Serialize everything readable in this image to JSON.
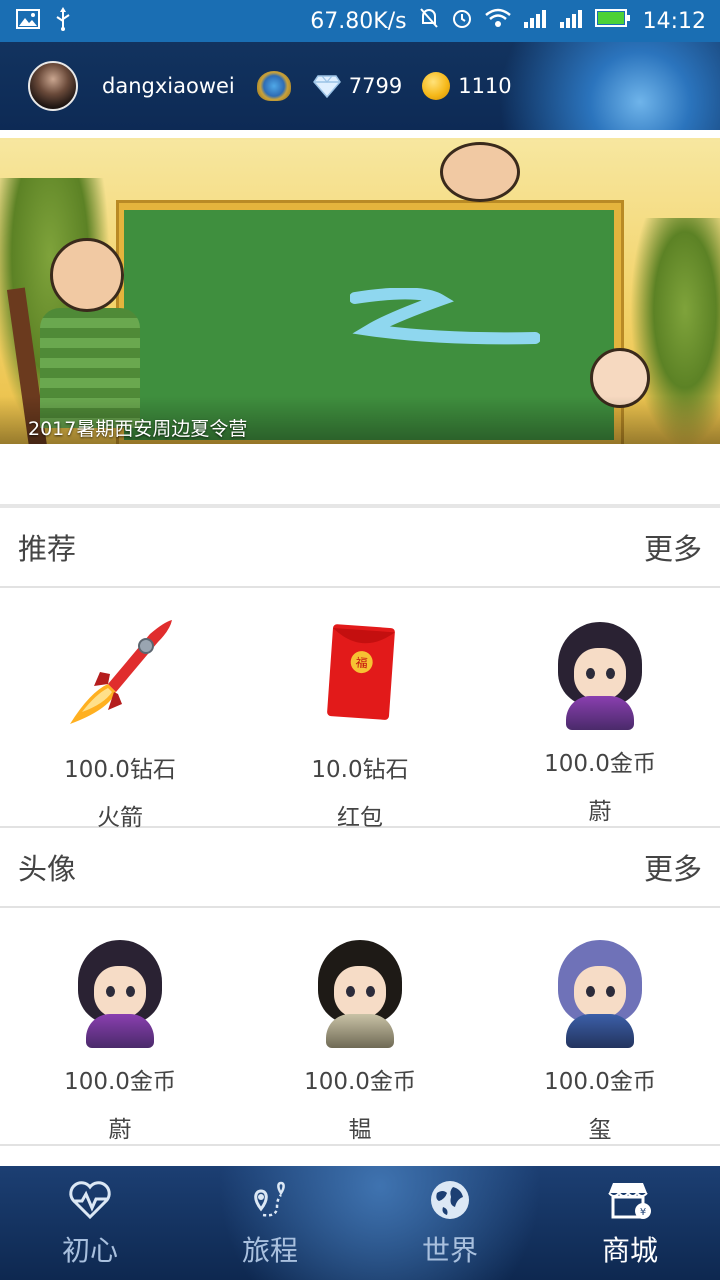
{
  "status_bar": {
    "network_speed": "67.80K/s",
    "time": "14:12"
  },
  "header": {
    "username": "dangxiaowei",
    "diamonds": "7799",
    "coins": "1110"
  },
  "banner": {
    "caption": "2017暑期西安周边夏令营"
  },
  "sections": [
    {
      "title": "推荐",
      "more_label": "更多",
      "items": [
        {
          "price": "100.0钻石",
          "name": "火箭",
          "icon": "rocket-icon"
        },
        {
          "price": "10.0钻石",
          "name": "红包",
          "icon": "red-envelope-icon"
        },
        {
          "price": "100.0金币",
          "name": "蔚",
          "icon": "avatar-wei"
        }
      ]
    },
    {
      "title": "头像",
      "more_label": "更多",
      "items": [
        {
          "price": "100.0金币",
          "name": "蔚",
          "icon": "avatar-wei"
        },
        {
          "price": "100.0金币",
          "name": "韫",
          "icon": "avatar-yun"
        },
        {
          "price": "100.0金币",
          "name": "玺",
          "icon": "avatar-xi"
        }
      ]
    }
  ],
  "nav": {
    "items": [
      {
        "label": "初心",
        "icon": "heartbeat-icon"
      },
      {
        "label": "旅程",
        "icon": "route-icon"
      },
      {
        "label": "世界",
        "icon": "globe-icon"
      },
      {
        "label": "商城",
        "icon": "shop-icon",
        "active": true
      }
    ]
  },
  "colors": {
    "status_bar": "#1a6eb3",
    "header_bg": "#0d2a55",
    "nav_bg": "#1c3f73",
    "nav_label": "#a9c0de",
    "nav_label_active": "#ffffff",
    "text": "#444444"
  }
}
